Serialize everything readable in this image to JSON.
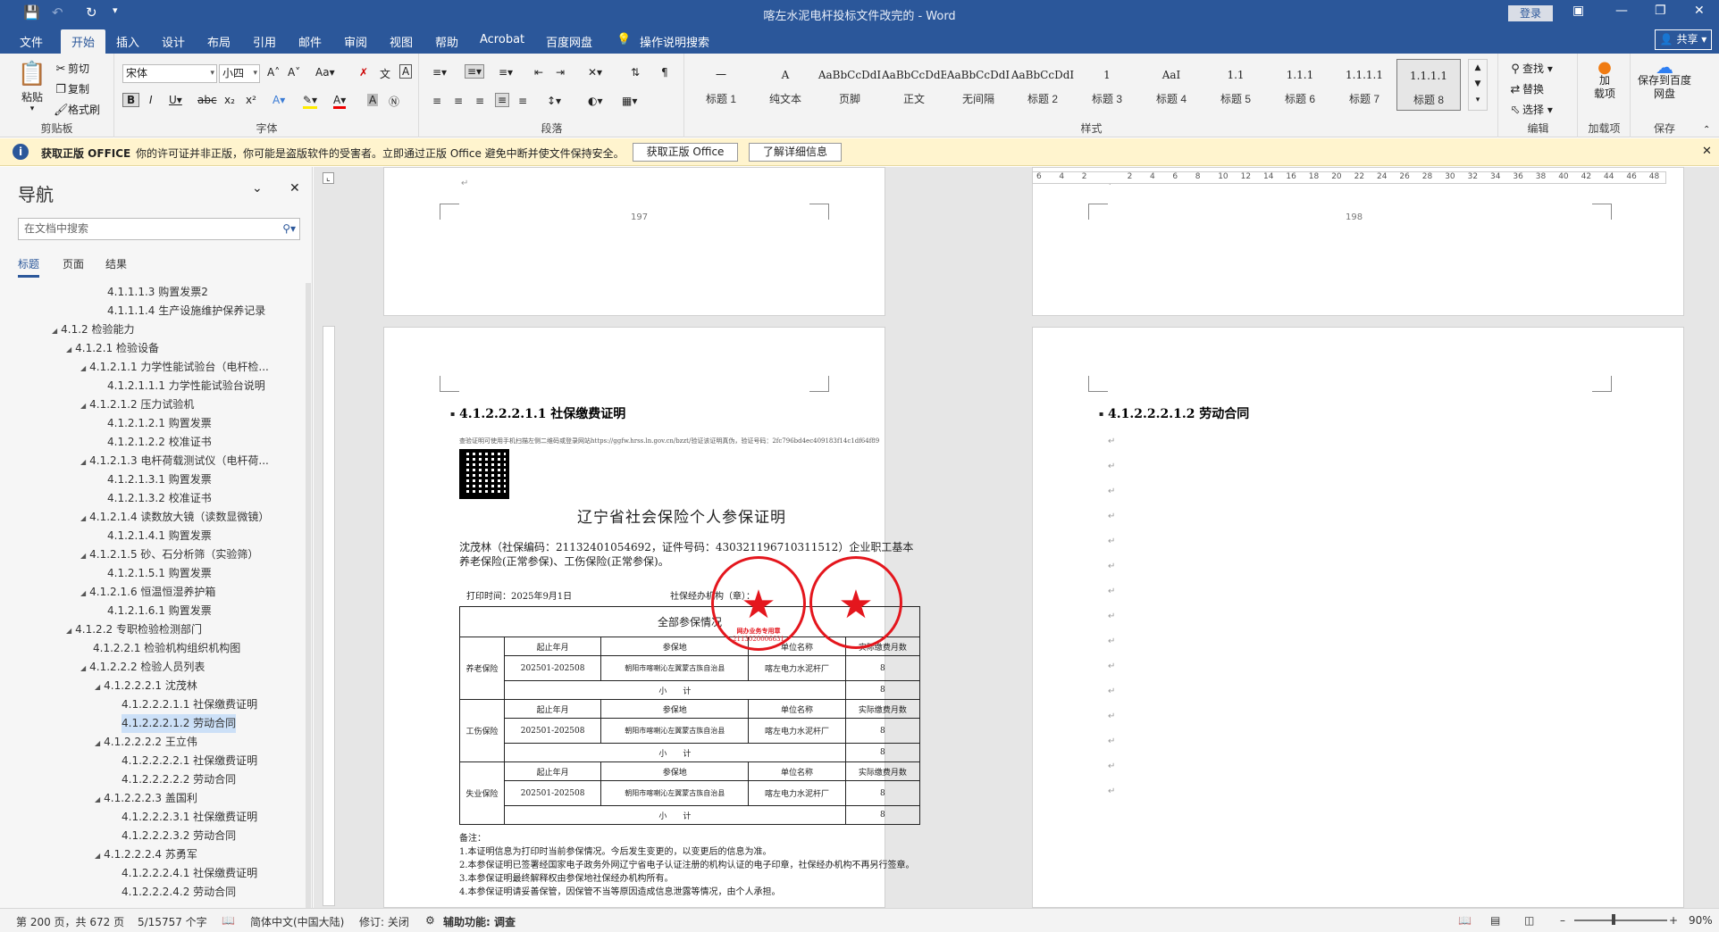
{
  "titlebar": {
    "doc_title": "喀左水泥电杆投标文件改完的 - Word",
    "login": "登录",
    "share": "共享"
  },
  "tabs": [
    "文件",
    "开始",
    "插入",
    "设计",
    "布局",
    "引用",
    "邮件",
    "审阅",
    "视图",
    "帮助",
    "Acrobat",
    "百度网盘",
    "操作说明搜索"
  ],
  "clipboard": {
    "paste": "粘贴",
    "cut": "剪切",
    "copy": "复制",
    "format_painter": "格式刷",
    "label": "剪贴板"
  },
  "font": {
    "name": "宋体",
    "size": "小四",
    "label": "字体"
  },
  "paragraph": {
    "label": "段落"
  },
  "styles": {
    "label": "样式",
    "items": [
      {
        "sample": "一",
        "name": "标题 1"
      },
      {
        "sample": "A",
        "name": "纯文本"
      },
      {
        "sample": "AaBbCcDdI",
        "name": "页脚"
      },
      {
        "sample": "AaBbCcDdEe",
        "name": "正文"
      },
      {
        "sample": "AaBbCcDdI",
        "name": "无间隔"
      },
      {
        "sample": "AaBbCcDdI",
        "name": "标题 2"
      },
      {
        "sample": "1",
        "name": "标题 3"
      },
      {
        "sample": "AaI",
        "name": "标题 4"
      },
      {
        "sample": "1.1",
        "name": "标题 5"
      },
      {
        "sample": "1.1.1",
        "name": "标题 6"
      },
      {
        "sample": "1.1.1.1",
        "name": "标题 7"
      },
      {
        "sample": "1.1.1.1",
        "name": "标题 8"
      }
    ]
  },
  "editing": {
    "find": "查找",
    "replace": "替换",
    "select": "选择",
    "label": "编辑"
  },
  "addins": {
    "label": "加载项",
    "btn": "加\n载项"
  },
  "save": {
    "label": "保存",
    "btn": "保存到百度网盘"
  },
  "infobar": {
    "title": "获取正版 OFFICE",
    "message": "你的许可证并非正版，你可能是盗版软件的受害者。立即通过正版 Office 避免中断并使文件保持安全。",
    "btn1": "获取正版 Office",
    "btn2": "了解详细信息"
  },
  "nav": {
    "title": "导航",
    "search_placeholder": "在文档中搜索",
    "tabs": [
      "标题",
      "页面",
      "结果"
    ],
    "items": [
      {
        "t": "4.1.1.1.3 购置发票2",
        "lvl": 5,
        "tri": false
      },
      {
        "t": "4.1.1.1.4 生产设施维护保养记录",
        "lvl": 5,
        "tri": false
      },
      {
        "t": "4.1.2 检验能力",
        "lvl": 2,
        "tri": true
      },
      {
        "t": "4.1.2.1 检验设备",
        "lvl": 3,
        "tri": true
      },
      {
        "t": "4.1.2.1.1 力学性能试验台（电杆检...",
        "lvl": 4,
        "tri": true
      },
      {
        "t": "4.1.2.1.1.1 力学性能试验台说明",
        "lvl": 5,
        "tri": false
      },
      {
        "t": "4.1.2.1.2 压力试验机",
        "lvl": 4,
        "tri": true
      },
      {
        "t": "4.1.2.1.2.1 购置发票",
        "lvl": 5,
        "tri": false
      },
      {
        "t": "4.1.2.1.2.2 校准证书",
        "lvl": 5,
        "tri": false
      },
      {
        "t": "4.1.2.1.3 电杆荷载测试仪（电杆荷...",
        "lvl": 4,
        "tri": true
      },
      {
        "t": "4.1.2.1.3.1 购置发票",
        "lvl": 5,
        "tri": false
      },
      {
        "t": "4.1.2.1.3.2 校准证书",
        "lvl": 5,
        "tri": false
      },
      {
        "t": "4.1.2.1.4 读数放大镜（读数显微镜）",
        "lvl": 4,
        "tri": true
      },
      {
        "t": "4.1.2.1.4.1 购置发票",
        "lvl": 5,
        "tri": false
      },
      {
        "t": "4.1.2.1.5 砂、石分析筛（实验筛）",
        "lvl": 4,
        "tri": true
      },
      {
        "t": "4.1.2.1.5.1 购置发票",
        "lvl": 5,
        "tri": false
      },
      {
        "t": "4.1.2.1.6 恒温恒湿养护箱",
        "lvl": 4,
        "tri": true
      },
      {
        "t": "4.1.2.1.6.1 购置发票",
        "lvl": 5,
        "tri": false
      },
      {
        "t": "4.1.2.2 专职检验检测部门",
        "lvl": 3,
        "tri": true
      },
      {
        "t": "4.1.2.2.1 检验机构组织机构图",
        "lvl": 4,
        "tri": false
      },
      {
        "t": "4.1.2.2.2 检验人员列表",
        "lvl": 4,
        "tri": true
      },
      {
        "t": "4.1.2.2.2.1 沈茂林",
        "lvl": 5,
        "tri": true
      },
      {
        "t": "4.1.2.2.2.1.1 社保缴费证明",
        "lvl": 6,
        "tri": false
      },
      {
        "t": "4.1.2.2.2.1.2 劳动合同",
        "lvl": 6,
        "tri": false,
        "sel": true
      },
      {
        "t": "4.1.2.2.2.2 王立伟",
        "lvl": 5,
        "tri": true
      },
      {
        "t": "4.1.2.2.2.2.1 社保缴费证明",
        "lvl": 6,
        "tri": false
      },
      {
        "t": "4.1.2.2.2.2.2 劳动合同",
        "lvl": 6,
        "tri": false
      },
      {
        "t": "4.1.2.2.2.3 盖国利",
        "lvl": 5,
        "tri": true
      },
      {
        "t": "4.1.2.2.2.3.1 社保缴费证明",
        "lvl": 6,
        "tri": false
      },
      {
        "t": "4.1.2.2.2.3.2 劳动合同",
        "lvl": 6,
        "tri": false
      },
      {
        "t": "4.1.2.2.2.4 苏勇军",
        "lvl": 5,
        "tri": true
      },
      {
        "t": "4.1.2.2.2.4.1 社保缴费证明",
        "lvl": 6,
        "tri": false
      },
      {
        "t": "4.1.2.2.2.4.2 劳动合同",
        "lvl": 6,
        "tri": false
      }
    ]
  },
  "pages": {
    "p197": "197",
    "p198": "198",
    "h1": "4.1.2.2.2.1.1 社保缴费证明",
    "h2": "4.1.2.2.2.1.2 劳动合同"
  },
  "cert": {
    "url": "查验证明可使用手机扫描左侧二维码或登录网站https://ggfw.hrss.ln.gov.cn/bzzt/验证该证明真伪，验证号码：2fc796bd4ec409183f14c1df64f89",
    "title": "辽宁省社会保险个人参保证明",
    "body": "沈茂林（社保编码：21132401054692，证件号码：430321196710311512）企业职工基本养老保险(正常参保)、工伤保险(正常参保)。",
    "print_time": "打印时间：2025年9月1日",
    "agency": "社保经办机构（章）：",
    "table_head": "全部参保情况",
    "col_period": "起止年月",
    "col_place": "参保地",
    "col_unit": "单位名称",
    "col_months": "实际缴费月数",
    "unit_name_partial": "单位名称",
    "rows": [
      {
        "type": "养老保险",
        "period": "202501-202508",
        "place": "朝阳市喀喇沁左翼蒙古族自治县",
        "unit": "喀左电力水泥杆厂",
        "months": "8",
        "subtotal": "小　　计",
        "sub_months": "8"
      },
      {
        "type": "工伤保险",
        "period": "202501-202508",
        "place": "朝阳市喀喇沁左翼蒙古族自治县",
        "unit": "喀左电力水泥杆厂",
        "months": "8",
        "subtotal": "小　　计",
        "sub_months": "8"
      },
      {
        "type": "失业保险",
        "period": "202501-202508",
        "place": "朝阳市喀喇沁左翼蒙古族自治县",
        "unit": "喀左电力水泥杆厂",
        "months": "8",
        "subtotal": "小　　计",
        "sub_months": "8"
      }
    ],
    "notes": [
      "备注：",
      "1.本证明信息为打印时当前参保情况。今后发生变更的，以变更后的信息为准。",
      "2.本参保证明已签署经国家电子政务外网辽宁省电子认证注册的机构认证的电子印章，社保经办机构不再另行签章。",
      "3.本参保证明最终解释权由参保地社保经办机构所有。",
      "4.本参保证明请妥善保管，因保管不当等原因造成信息泄露等情况，由个人承担。"
    ],
    "stamp1_text": "网办业务专用章",
    "stamp1_code": "2113020006631"
  },
  "status": {
    "page": "第 200 页，共 672 页",
    "words": "5/15757 个字",
    "lang": "简体中文(中国大陆)",
    "track": "修订: 关闭",
    "access": "辅助功能: 调查",
    "zoom": "90%"
  },
  "ruler_labels": [
    "6",
    "4",
    "2",
    "",
    "2",
    "4",
    "6",
    "8",
    "10",
    "12",
    "14",
    "16",
    "18",
    "20",
    "22",
    "24",
    "26",
    "28",
    "30",
    "32",
    "34",
    "36",
    "38",
    "40",
    "42",
    "44",
    "46",
    "48"
  ],
  "colors": {
    "brand": "#2b579a",
    "stamp": "#e4161d",
    "infobar": "#fff4ce"
  }
}
